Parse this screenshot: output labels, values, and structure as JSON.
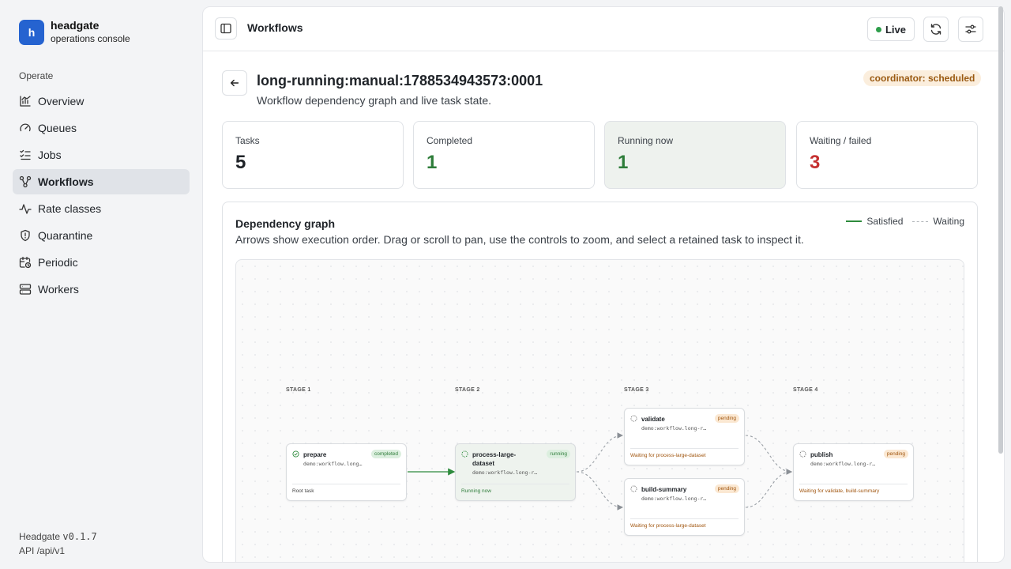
{
  "app": {
    "logo_letter": "h",
    "name": "headgate",
    "subtitle": "operations console"
  },
  "sidebar": {
    "section_label": "Operate",
    "items": [
      {
        "label": "Overview",
        "icon": "chart-icon"
      },
      {
        "label": "Queues",
        "icon": "gauge-icon"
      },
      {
        "label": "Jobs",
        "icon": "checklist-icon"
      },
      {
        "label": "Workflows",
        "icon": "workflow-icon",
        "active": true
      },
      {
        "label": "Rate classes",
        "icon": "pulse-icon"
      },
      {
        "label": "Quarantine",
        "icon": "shield-icon"
      },
      {
        "label": "Periodic",
        "icon": "calendar-clock-icon"
      },
      {
        "label": "Workers",
        "icon": "server-icon"
      }
    ],
    "footer": {
      "version_prefix": "Headgate ",
      "version": "v0.1.7",
      "api_prefix": "API ",
      "api_path": "/api/v1"
    }
  },
  "topbar": {
    "title": "Workflows",
    "live_label": "Live"
  },
  "workflow": {
    "title": "long-running:manual:1788534943573:0001",
    "subtitle": "Workflow dependency graph and live task state.",
    "coordinator_badge": "coordinator: scheduled"
  },
  "stats": [
    {
      "label": "Tasks",
      "value": "5",
      "color": "#1f2328"
    },
    {
      "label": "Completed",
      "value": "1",
      "color": "#2e7d3a"
    },
    {
      "label": "Running now",
      "value": "1",
      "color": "#2e7d3a"
    },
    {
      "label": "Waiting / failed",
      "value": "3",
      "color": "#c53030"
    }
  ],
  "graph": {
    "title": "Dependency graph",
    "description": "Arrows show execution order. Drag or scroll to pan, use the controls to zoom, and select a retained task to inspect it.",
    "legend": {
      "satisfied": "Satisfied",
      "waiting": "Waiting"
    },
    "stages": [
      "STAGE 1",
      "STAGE 2",
      "STAGE 3",
      "STAGE 4"
    ],
    "nodes": {
      "prepare": {
        "name": "prepare",
        "status": "completed",
        "fn": "demo:workflow.long…",
        "footer": "Root task"
      },
      "process": {
        "name": "process-large-dataset",
        "status": "running",
        "fn": "demo:workflow.long-r…",
        "footer": "Running now"
      },
      "validate": {
        "name": "validate",
        "status": "pending",
        "fn": "demo:workflow.long-r…",
        "footer": "Waiting for process-large-dataset"
      },
      "summary": {
        "name": "build-summary",
        "status": "pending",
        "fn": "demo:workflow.long-r…",
        "footer": "Waiting for process-large-dataset"
      },
      "publish": {
        "name": "publish",
        "status": "pending",
        "fn": "demo:workflow.long-r…",
        "footer": "Waiting for validate, build-summary"
      }
    }
  },
  "colors": {
    "accent": "#2563d0",
    "satisfied": "#2e8b3d",
    "waiting": "#9aa0a6",
    "pending_text": "#a0550e"
  }
}
